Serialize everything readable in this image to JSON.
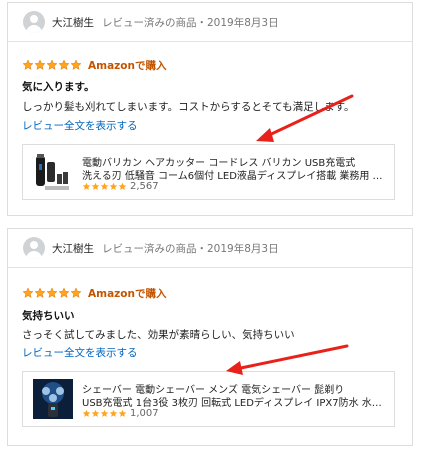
{
  "colors": {
    "star": "#ffa41c",
    "star_stroke": "#e47911",
    "purchase": "#c45500",
    "link": "#0066c0",
    "arrow": "#e8221a"
  },
  "reviews": [
    {
      "reviewer": "大江樹生",
      "meta": "レビュー済みの商品・2019年8月3日",
      "rating": 5,
      "purchase_label": "Amazonで購入",
      "title": "気に入ります。",
      "body": "しっかり髪も刈れてしまいます。コストからするとそても満足します。",
      "link": "レビュー全文を表示する",
      "product": {
        "name_line1": "電動バリカン ヘアカッター コードレス バリカン USB充電式",
        "name_line2": "洗える刃 低騒音 コーム6個付 LED液晶ディスプレイ搭載 業務用 …",
        "rating": 5,
        "rating_count": "2,567",
        "thumb_icon": "hair-clipper-icon"
      }
    },
    {
      "reviewer": "大江樹生",
      "meta": "レビュー済みの商品・2019年8月3日",
      "rating": 5,
      "purchase_label": "Amazonで購入",
      "title": "気持ちいい",
      "body": "さっそく試してみました、効果が素晴らしい、気持ちいい",
      "link": "レビュー全文を表示する",
      "product": {
        "name_line1": "シェーバー 電動シェーバー メンズ 電気シェーバー 髭剃り",
        "name_line2": "USB充電式 1台3役 3枚刃 回転式 LEDディスプレイ IPX7防水 水…",
        "rating": 5,
        "rating_count": "1,007",
        "thumb_icon": "electric-shaver-icon"
      }
    }
  ]
}
